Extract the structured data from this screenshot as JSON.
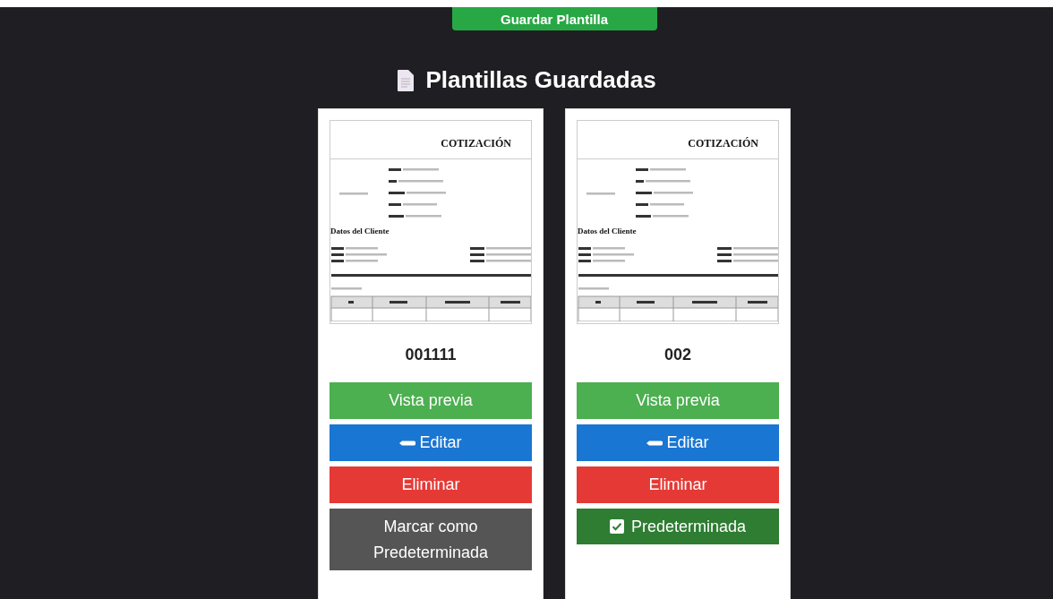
{
  "save_button": {
    "label": "Guardar Plantilla"
  },
  "heading": {
    "title": "Plantillas Guardadas"
  },
  "templates": [
    {
      "preview": {
        "title": "COTIZACIÓN",
        "client_title": "Datos del Cliente"
      },
      "name": "001111",
      "preview_button": "Vista previa",
      "edit_button": "Editar",
      "delete_button": "Eliminar",
      "is_default": false,
      "default_button": "Marcar como Predeterminada"
    },
    {
      "preview": {
        "title": "COTIZACIÓN",
        "client_title": "Datos del Cliente"
      },
      "name": "002",
      "preview_button": "Vista previa",
      "edit_button": "Editar",
      "delete_button": "Eliminar",
      "is_default": true,
      "default_button": "Predeterminada"
    }
  ]
}
